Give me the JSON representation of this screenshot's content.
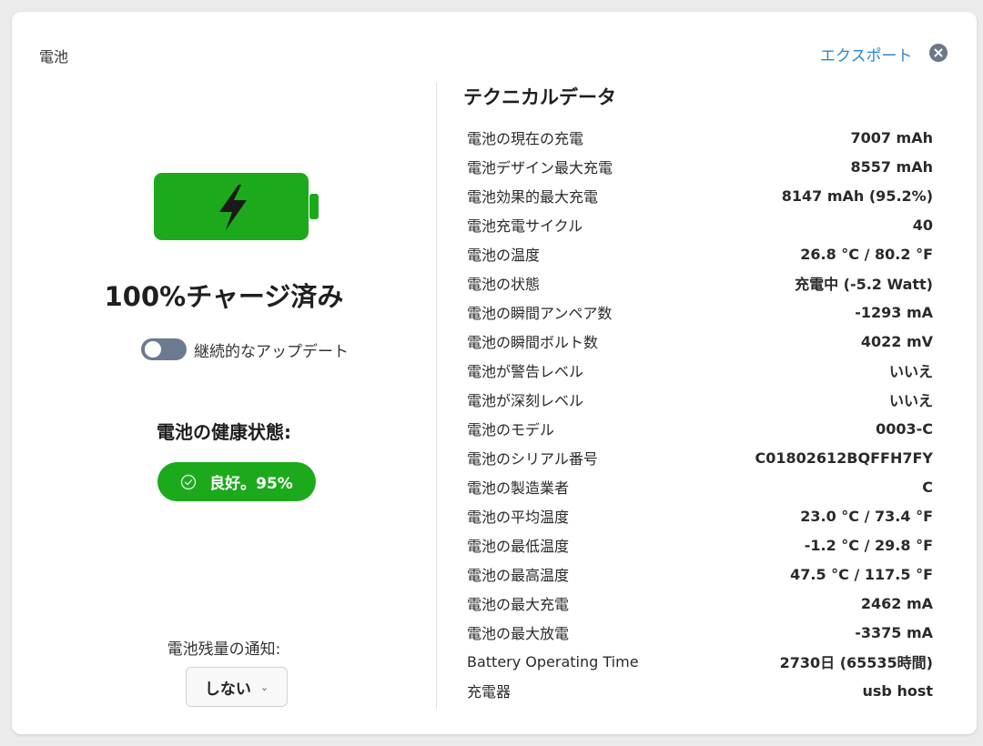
{
  "header": {
    "title": "電池",
    "export_label": "エクスポート",
    "close_icon": "close-icon"
  },
  "battery": {
    "icon": "battery-charging-icon",
    "fill_color": "#1caa1c",
    "charge_level": 1.0,
    "status_text": "100%チャージ済み",
    "continuous_update_label": "継続的なアップデート",
    "continuous_update_on": false
  },
  "health": {
    "title": "電池の健康状態:",
    "badge_text": "良好。95%",
    "badge_color": "#1caa1c"
  },
  "notification": {
    "label": "電池残量の通知:",
    "selected": "しない"
  },
  "tech": {
    "title": "テクニカルデータ",
    "rows": [
      {
        "label": "電池の現在の充電",
        "value": "7007 mAh"
      },
      {
        "label": "電池デザイン最大充電",
        "value": "8557 mAh"
      },
      {
        "label": "電池効果的最大充電",
        "value": "8147 mAh (95.2%)"
      },
      {
        "label": "電池充電サイクル",
        "value": "40"
      },
      {
        "label": "電池の温度",
        "value": "26.8 °C / 80.2 °F"
      },
      {
        "label": "電池の状態",
        "value": "充電中 (-5.2 Watt)"
      },
      {
        "label": "電池の瞬間アンペア数",
        "value": "-1293 mA"
      },
      {
        "label": "電池の瞬間ボルト数",
        "value": "4022 mV"
      },
      {
        "label": "電池が警告レベル",
        "value": "いいえ"
      },
      {
        "label": "電池が深刻レベル",
        "value": "いいえ"
      },
      {
        "label": "電池のモデル",
        "value": "0003-C"
      },
      {
        "label": "電池のシリアル番号",
        "value": "C01802612BQFFH7FY"
      },
      {
        "label": "電池の製造業者",
        "value": "C"
      },
      {
        "label": "電池の平均温度",
        "value": "23.0 °C / 73.4 °F"
      },
      {
        "label": "電池の最低温度",
        "value": "-1.2 °C / 29.8 °F"
      },
      {
        "label": "電池の最高温度",
        "value": "47.5 °C / 117.5 °F"
      },
      {
        "label": "電池の最大充電",
        "value": "2462 mA"
      },
      {
        "label": "電池の最大放電",
        "value": "-3375 mA"
      },
      {
        "label": "Battery Operating Time",
        "value": "2730日 (65535時間)"
      },
      {
        "label": "充電器",
        "value": "usb host"
      }
    ]
  }
}
